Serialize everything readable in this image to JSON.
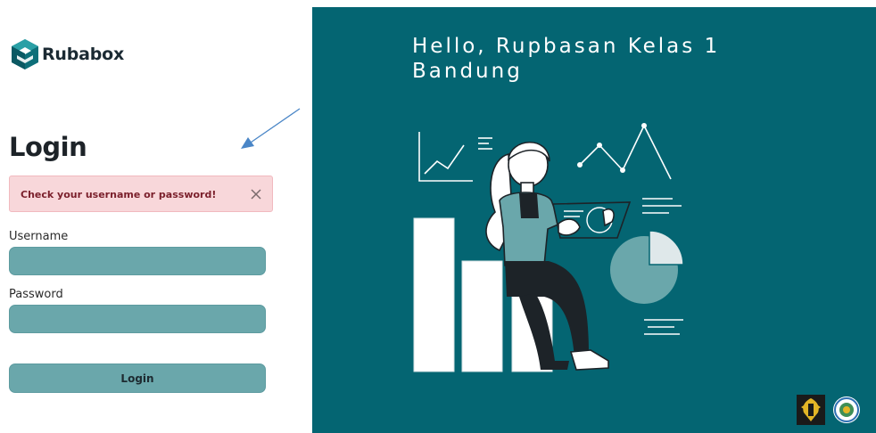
{
  "brand": {
    "name": "Rubabox",
    "icon": "rubabox-logo-icon"
  },
  "login": {
    "title": "Login",
    "alert_message": "Check your username or password!",
    "username_label": "Username",
    "username_value": "",
    "password_label": "Password",
    "password_value": "",
    "submit_label": "Login"
  },
  "hero": {
    "greeting": "Hello, Rupbasan Kelas 1 Bandung",
    "illustration": "data-analytics-woman-illustration",
    "emblems": [
      "ministry-emblem-icon",
      "seal-emblem-icon"
    ]
  },
  "colors": {
    "panel": "#046572",
    "input": "#6aa7ab",
    "alert_bg": "#f8d7da",
    "alert_text": "#7a1f2b",
    "annotation_arrow": "#4a86c7"
  }
}
